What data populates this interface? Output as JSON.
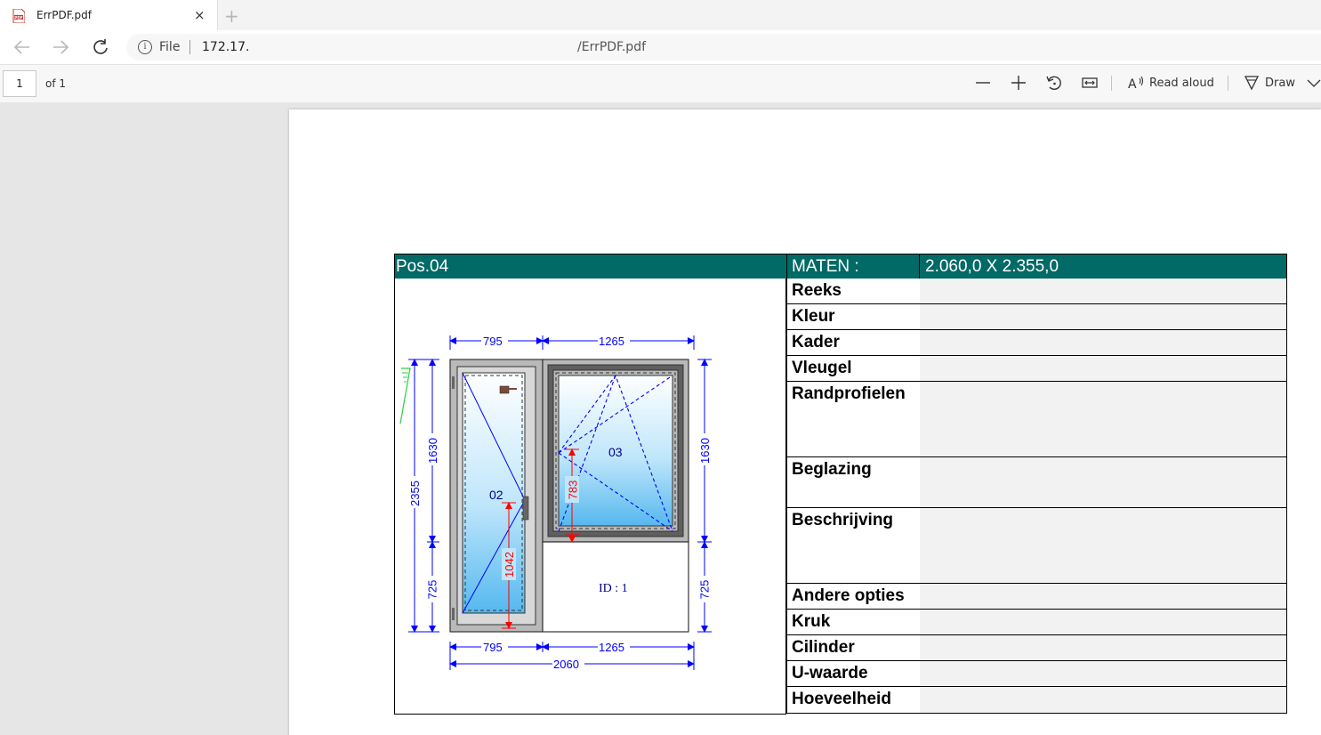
{
  "tab": {
    "title": "ErrPDF.pdf",
    "close": "×",
    "new_tab": "+"
  },
  "address": {
    "scheme": "File",
    "host": "172.17.",
    "path": "/ErrPDF.pdf"
  },
  "pdf_toolbar": {
    "page_number": "1",
    "page_count": "of 1",
    "read_aloud": "Read aloud",
    "draw": "Draw"
  },
  "document": {
    "position": "Pos.04",
    "maten_label": "MATEN :",
    "maten_value": "2.060,0  X  2.355,0",
    "rows": [
      {
        "label": "Reeks",
        "value": ""
      },
      {
        "label": "Kleur",
        "value": ""
      },
      {
        "label": "Kader",
        "value": ""
      },
      {
        "label": "Vleugel",
        "value": ""
      },
      {
        "label": "Randprofielen",
        "value": ""
      },
      {
        "label": "Beglazing",
        "value": ""
      },
      {
        "label": "Beschrijving",
        "value": ""
      },
      {
        "label": "Andere opties",
        "value": ""
      },
      {
        "label": "Kruk",
        "value": ""
      },
      {
        "label": "Cilinder",
        "value": ""
      },
      {
        "label": "U-waarde",
        "value": ""
      },
      {
        "label": "Hoeveelheid",
        "value": ""
      }
    ],
    "drawing": {
      "dim_top_left": "795",
      "dim_top_right": "1265",
      "dim_bottom_left": "795",
      "dim_bottom_right": "1265",
      "dim_total_width": "2060",
      "dim_total_height": "2355",
      "dim_upper_left": "1630",
      "dim_lower_left": "725",
      "dim_upper_right": "1630",
      "dim_lower_right": "725",
      "handle_height_door": "1042",
      "handle_height_window": "783",
      "door_label": "02",
      "window_label": "03",
      "panel_id": "ID : 1"
    }
  },
  "colors": {
    "header_bg": "#006a66",
    "dimension": "#0000ff",
    "handle_dim": "#ff0000",
    "value_cell": "#f2f2f2"
  }
}
